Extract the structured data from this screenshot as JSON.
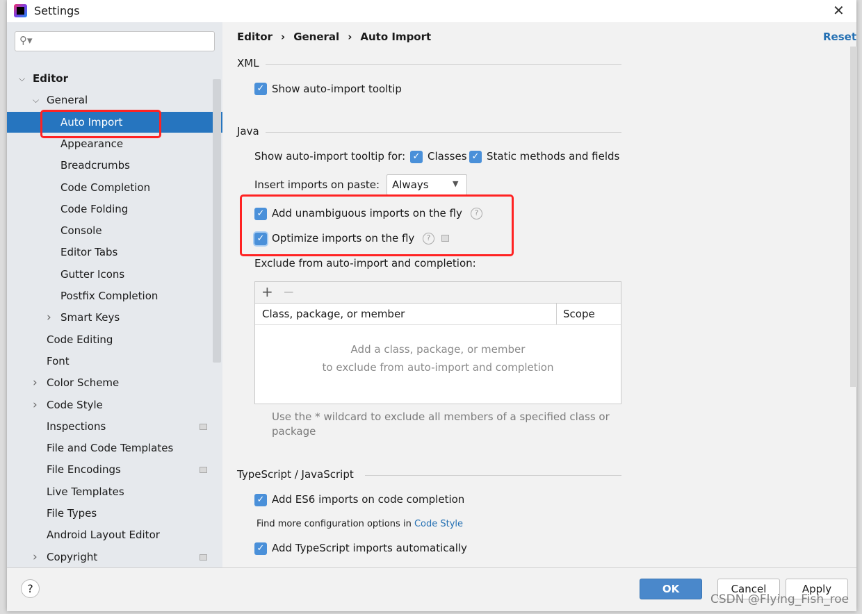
{
  "window": {
    "title": "Settings"
  },
  "sidebar": {
    "search_placeholder": "",
    "items": [
      {
        "label": "Editor",
        "level": 1,
        "expanded": true,
        "bold": true
      },
      {
        "label": "General",
        "level": 2,
        "expanded": true
      },
      {
        "label": "Auto Import",
        "level": 3,
        "selected": true
      },
      {
        "label": "Appearance",
        "level": 3
      },
      {
        "label": "Breadcrumbs",
        "level": 3
      },
      {
        "label": "Code Completion",
        "level": 3
      },
      {
        "label": "Code Folding",
        "level": 3
      },
      {
        "label": "Console",
        "level": 3
      },
      {
        "label": "Editor Tabs",
        "level": 3
      },
      {
        "label": "Gutter Icons",
        "level": 3
      },
      {
        "label": "Postfix Completion",
        "level": 3
      },
      {
        "label": "Smart Keys",
        "level": 3,
        "collapsed": true
      },
      {
        "label": "Code Editing",
        "level": 2
      },
      {
        "label": "Font",
        "level": 2
      },
      {
        "label": "Color Scheme",
        "level": 2,
        "collapsed": true
      },
      {
        "label": "Code Style",
        "level": 2,
        "collapsed": true
      },
      {
        "label": "Inspections",
        "level": 2,
        "badge": true
      },
      {
        "label": "File and Code Templates",
        "level": 2
      },
      {
        "label": "File Encodings",
        "level": 2,
        "badge": true
      },
      {
        "label": "Live Templates",
        "level": 2
      },
      {
        "label": "File Types",
        "level": 2
      },
      {
        "label": "Android Layout Editor",
        "level": 2
      },
      {
        "label": "Copyright",
        "level": 2,
        "collapsed": true,
        "badge": true
      }
    ]
  },
  "breadcrumb": [
    "Editor",
    "General",
    "Auto Import"
  ],
  "reset_label": "Reset",
  "xml": {
    "title": "XML",
    "show_tooltip": {
      "label": "Show auto-import tooltip",
      "checked": true
    }
  },
  "java": {
    "title": "Java",
    "tooltip_for_label": "Show auto-import tooltip for:",
    "classes": {
      "label": "Classes",
      "checked": true
    },
    "static": {
      "label": "Static methods and fields",
      "checked": true
    },
    "paste_label": "Insert imports on paste:",
    "paste_value": "Always",
    "unambiguous": {
      "label": "Add unambiguous imports on the fly",
      "checked": true
    },
    "optimize": {
      "label": "Optimize imports on the fly",
      "checked": true
    },
    "exclude_label": "Exclude from auto-import and completion:",
    "table": {
      "col1": "Class, package, or member",
      "col2": "Scope",
      "empty1": "Add a class, package, or member",
      "empty2": "to exclude from auto-import and completion"
    },
    "hint1": "Use the * wildcard to exclude all members of a specified class or",
    "hint2": "package"
  },
  "ts": {
    "title": "TypeScript / JavaScript",
    "es6": {
      "label": "Add ES6 imports on code completion",
      "checked": true
    },
    "more_prefix": "Find more configuration options in",
    "more_link": "Code Style",
    "ts_auto": {
      "label": "Add TypeScript imports automatically",
      "checked": true
    }
  },
  "footer": {
    "ok": "OK",
    "cancel": "Cancel",
    "apply": "Apply"
  },
  "watermark": "CSDN @Flying_Fish_roe",
  "colors": {
    "accent": "#2675bf",
    "checkbox": "#4a90d9",
    "highlight": "#ff2222",
    "link": "#2470b3"
  }
}
